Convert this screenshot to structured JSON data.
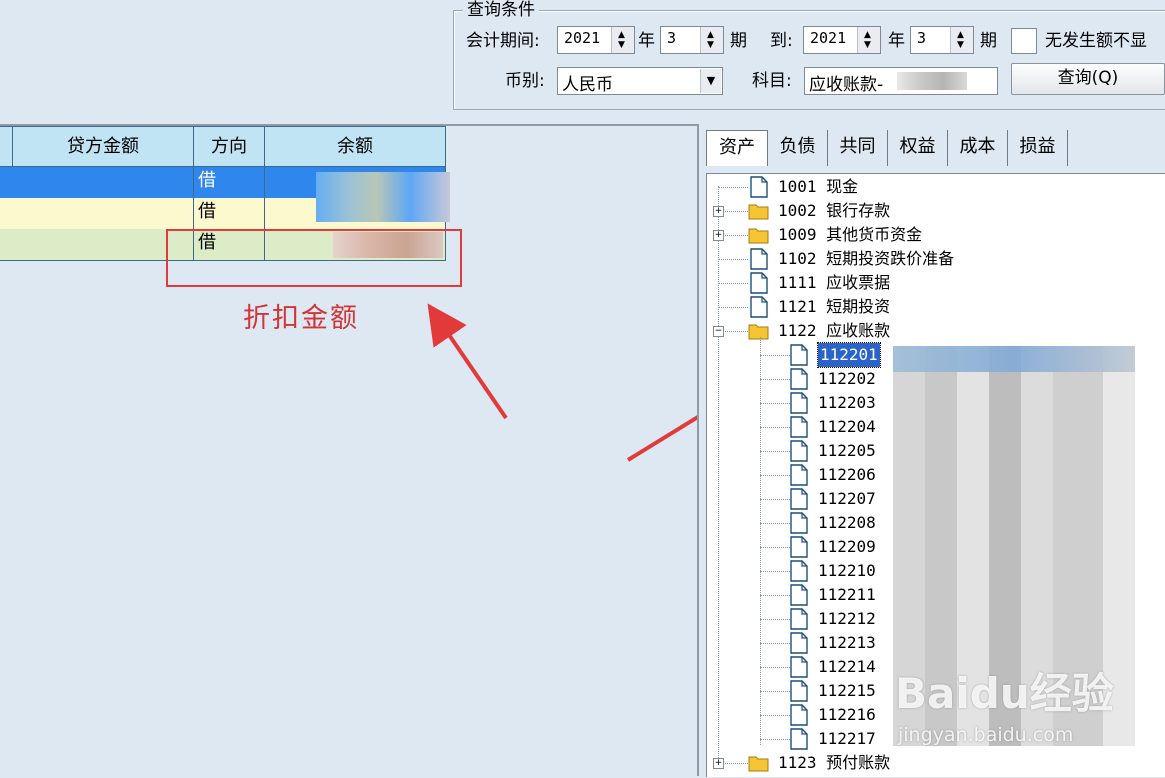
{
  "query": {
    "legend": "查询条件",
    "period_label": "会计期间:",
    "from_year": "2021",
    "year_unit": "年",
    "from_period": "3",
    "period_unit": "期",
    "to_label": "到:",
    "to_year": "2021",
    "to_period": "3",
    "no_amount_label": "无发生额不显",
    "currency_label": "币别:",
    "currency_value": "人民币",
    "subject_label": "科目:",
    "subject_value": "应收账款-",
    "query_button": "查询(Q)"
  },
  "grid": {
    "columns": [
      "贷方金额",
      "方向",
      "余额"
    ],
    "rows": [
      {
        "direction": "借",
        "style": "selected"
      },
      {
        "direction": "借",
        "style": "yellow"
      },
      {
        "direction": "借",
        "style": "green"
      }
    ]
  },
  "annotation": {
    "label": "折扣金额"
  },
  "tabs": [
    "资产",
    "负债",
    "共同",
    "权益",
    "成本",
    "损益"
  ],
  "tree": {
    "nodes": [
      {
        "code": "1001",
        "name": "现金",
        "type": "leaf"
      },
      {
        "code": "1002",
        "name": "银行存款",
        "type": "folder",
        "expander": "+"
      },
      {
        "code": "1009",
        "name": "其他货币资金",
        "type": "folder",
        "expander": "+"
      },
      {
        "code": "1102",
        "name": "短期投资跌价准备",
        "type": "leaf"
      },
      {
        "code": "1111",
        "name": "应收票据",
        "type": "leaf"
      },
      {
        "code": "1121",
        "name": "短期投资",
        "type": "leaf"
      },
      {
        "code": "1122",
        "name": "应收账款",
        "type": "folder",
        "expander": "−"
      }
    ],
    "children": [
      "112201",
      "112202",
      "112203",
      "112204",
      "112205",
      "112206",
      "112207",
      "112208",
      "112209",
      "112210",
      "112211",
      "112212",
      "112213",
      "112214",
      "112215",
      "112216",
      "112217"
    ],
    "last_node": {
      "code": "1123",
      "name": "预付账款",
      "expander": "+"
    }
  },
  "watermark": {
    "brand": "Baidu经验",
    "url": "jingyan.baidu.com"
  },
  "colors": {
    "selected_row": "#2f87ee",
    "yellow_row": "#fdf9cf",
    "green_row": "#dcecc6",
    "header": "#c1e4f4",
    "annotation": "#e23a3a"
  }
}
